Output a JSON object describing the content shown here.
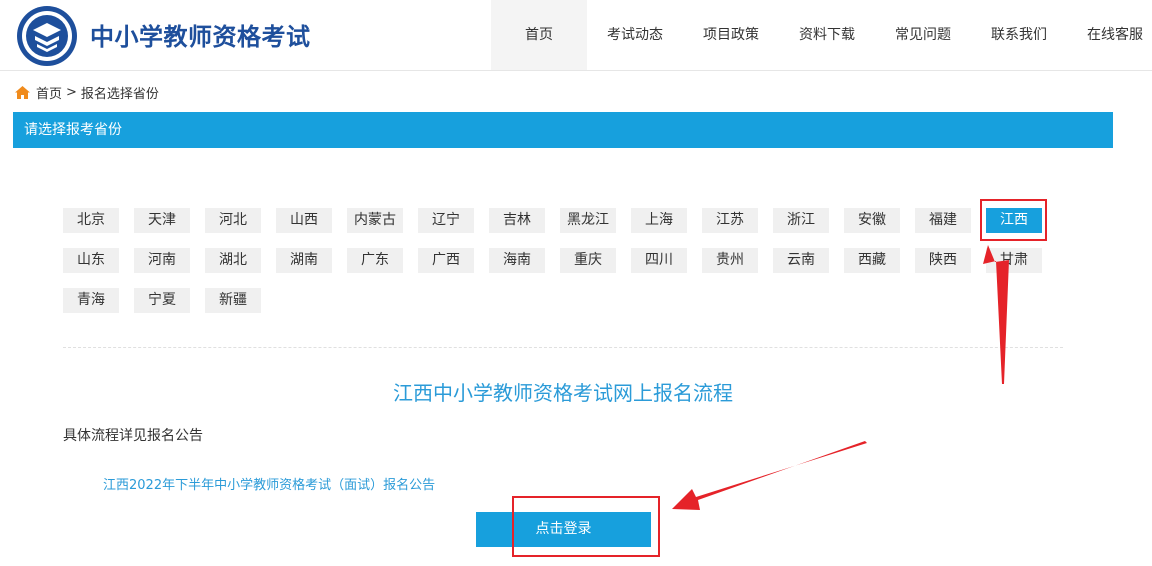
{
  "header": {
    "site_title": "中小学教师资格考试",
    "nav": [
      "首页",
      "考试动态",
      "项目政策",
      "资料下载",
      "常见问题",
      "联系我们",
      "在线客服"
    ]
  },
  "breadcrumb": {
    "home": "首页",
    "separator": ">",
    "current": "报名选择省份"
  },
  "section": {
    "title": "请选择报考省份"
  },
  "provinces": {
    "selected": "江西",
    "rows": [
      [
        "北京",
        "天津",
        "河北",
        "山西",
        "内蒙古",
        "辽宁",
        "吉林",
        "黑龙江",
        "上海",
        "江苏",
        "浙江",
        "安徽",
        "福建",
        "江西"
      ],
      [
        "山东",
        "河南",
        "湖北",
        "湖南",
        "广东",
        "广西",
        "海南",
        "重庆",
        "四川",
        "贵州",
        "云南",
        "西藏",
        "陕西",
        "甘肃"
      ],
      [
        "青海",
        "宁夏",
        "新疆"
      ]
    ]
  },
  "flow": {
    "title": "江西中小学教师资格考试网上报名流程",
    "description": "具体流程详见报名公告",
    "notice_link": "江西2022年下半年中小学教师资格考试（面试）报名公告"
  },
  "login_button": "点击登录",
  "colors": {
    "primary": "#17a0dd",
    "brand": "#1e4f9c",
    "highlight": "#e52329"
  },
  "icons": {
    "logo": "exam-logo-icon",
    "home": "home-icon"
  }
}
